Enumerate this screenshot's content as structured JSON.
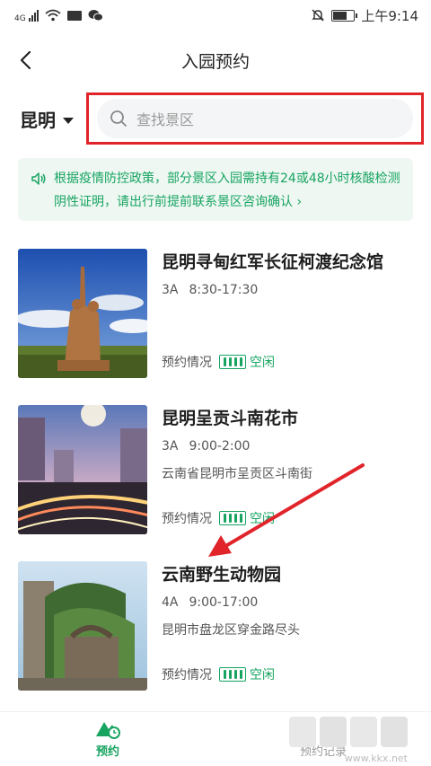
{
  "status_bar": {
    "network": "4G",
    "time": "上午9:14"
  },
  "nav": {
    "title": "入园预约"
  },
  "search": {
    "city": "昆明",
    "placeholder": "查找景区"
  },
  "notice": {
    "text": "根据疫情防控政策，部分景区入园需持有24或48小时核酸检测阴性证明，请出行前提前联系景区咨询确认 ›"
  },
  "attractions": [
    {
      "name": "昆明寻甸红军长征柯渡纪念馆",
      "level": "3A",
      "hours": "8:30-17:30",
      "address": "",
      "status_label": "预约情况",
      "status": "空闲"
    },
    {
      "name": "昆明呈贡斗南花市",
      "level": "3A",
      "hours": "9:00-2:00",
      "address": "云南省昆明市呈贡区斗南街",
      "status_label": "预约情况",
      "status": "空闲"
    },
    {
      "name": "云南野生动物园",
      "level": "4A",
      "hours": "9:00-17:00",
      "address": "昆明市盘龙区穿金路尽头",
      "status_label": "预约情况",
      "status": "空闲"
    }
  ],
  "tabs": [
    {
      "label": "预约",
      "active": true
    },
    {
      "label": "预约记录",
      "active": false
    }
  ],
  "watermark": {
    "text": "www.kkx.net"
  },
  "colors": {
    "accent": "#17a461",
    "highlight": "#e0242a",
    "notice_bg": "#eef7f2"
  }
}
